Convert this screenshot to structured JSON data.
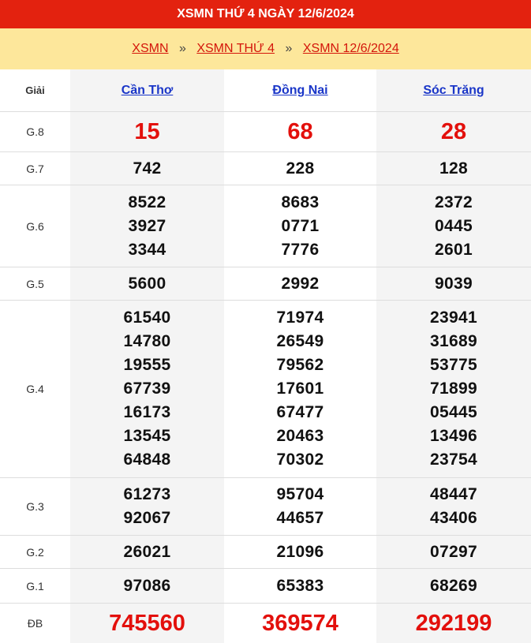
{
  "title": "XSMN THỨ 4 NGÀY 12/6/2024",
  "breadcrumb": {
    "items": [
      "XSMN",
      "XSMN THỨ 4",
      "XSMN 12/6/2024"
    ],
    "separator": "»"
  },
  "table": {
    "label_header": "Giải",
    "provinces": [
      "Cần Thơ",
      "Đồng Nai",
      "Sóc Trăng"
    ],
    "prizes": {
      "g8": {
        "label": "G.8",
        "values": [
          [
            "15"
          ],
          [
            "68"
          ],
          [
            "28"
          ]
        ]
      },
      "g7": {
        "label": "G.7",
        "values": [
          [
            "742"
          ],
          [
            "228"
          ],
          [
            "128"
          ]
        ]
      },
      "g6": {
        "label": "G.6",
        "values": [
          [
            "8522",
            "3927",
            "3344"
          ],
          [
            "8683",
            "0771",
            "7776"
          ],
          [
            "2372",
            "0445",
            "2601"
          ]
        ]
      },
      "g5": {
        "label": "G.5",
        "values": [
          [
            "5600"
          ],
          [
            "2992"
          ],
          [
            "9039"
          ]
        ]
      },
      "g4": {
        "label": "G.4",
        "values": [
          [
            "61540",
            "14780",
            "19555",
            "67739",
            "16173",
            "13545",
            "64848"
          ],
          [
            "71974",
            "26549",
            "79562",
            "17601",
            "67477",
            "20463",
            "70302"
          ],
          [
            "23941",
            "31689",
            "53775",
            "71899",
            "05445",
            "13496",
            "23754"
          ]
        ]
      },
      "g3": {
        "label": "G.3",
        "values": [
          [
            "61273",
            "92067"
          ],
          [
            "95704",
            "44657"
          ],
          [
            "48447",
            "43406"
          ]
        ]
      },
      "g2": {
        "label": "G.2",
        "values": [
          [
            "26021"
          ],
          [
            "21096"
          ],
          [
            "07297"
          ]
        ]
      },
      "g1": {
        "label": "G.1",
        "values": [
          [
            "97086"
          ],
          [
            "65383"
          ],
          [
            "68269"
          ]
        ]
      },
      "db": {
        "label": "ĐB",
        "values": [
          [
            "745560"
          ],
          [
            "369574"
          ],
          [
            "292199"
          ]
        ]
      }
    }
  },
  "colors": {
    "title_bg": "#e3220f",
    "breadcrumb_bg": "#fde79b",
    "link_red": "#d4160b",
    "province_link": "#1a36c8",
    "highlight_red": "#e3100c"
  }
}
